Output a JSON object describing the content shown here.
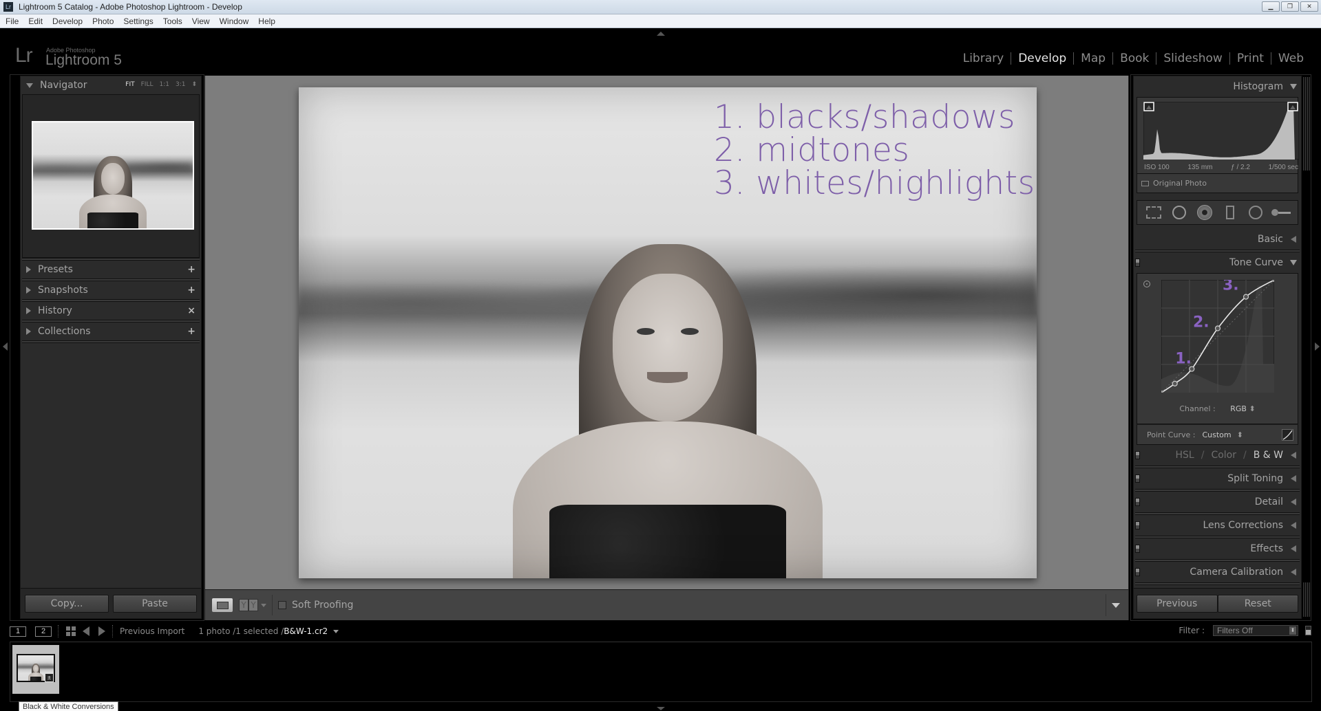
{
  "window": {
    "title": "Lightroom 5 Catalog - Adobe Photoshop Lightroom - Develop",
    "app_icon": "Lr",
    "controls": [
      "minimize",
      "restore",
      "close"
    ]
  },
  "menu": [
    "File",
    "Edit",
    "Develop",
    "Photo",
    "Settings",
    "Tools",
    "View",
    "Window",
    "Help"
  ],
  "brand": {
    "logo": "Lr",
    "small": "Adobe Photoshop",
    "big": "Lightroom 5"
  },
  "modules": [
    {
      "label": "Library",
      "active": false
    },
    {
      "label": "Develop",
      "active": true
    },
    {
      "label": "Map",
      "active": false
    },
    {
      "label": "Book",
      "active": false
    },
    {
      "label": "Slideshow",
      "active": false
    },
    {
      "label": "Print",
      "active": false
    },
    {
      "label": "Web",
      "active": false
    }
  ],
  "left_panel": {
    "navigator": {
      "title": "Navigator",
      "zoom_options": [
        "FIT",
        "FILL",
        "1:1",
        "3:1"
      ],
      "active_zoom": "FIT"
    },
    "sections": [
      {
        "label": "Presets",
        "action": "+"
      },
      {
        "label": "Snapshots",
        "action": "+"
      },
      {
        "label": "History",
        "action": "×"
      },
      {
        "label": "Collections",
        "action": "+"
      }
    ],
    "buttons": {
      "copy": "Copy...",
      "paste": "Paste"
    }
  },
  "main": {
    "annotation": [
      "1. blacks/shadows",
      "2. midtones",
      "3. whites/highlights"
    ],
    "annotation_color": "#7e5fa9"
  },
  "toolbar": {
    "yy_label": "Y",
    "soft_proofing": "Soft Proofing",
    "soft_proofing_checked": false
  },
  "right_panel": {
    "histogram": {
      "title": "Histogram",
      "iso": "ISO 100",
      "focal": "135 mm",
      "aperture": "ƒ / 2.2",
      "shutter": "1/500 sec",
      "original_photo": "Original Photo"
    },
    "tools": [
      "crop-overlay",
      "spot-removal",
      "red-eye-correction",
      "graduated-filter",
      "radial-filter",
      "adjustment-brush"
    ],
    "basic": "Basic",
    "tone_curve": {
      "title": "Tone Curve",
      "channel_label": "Channel :",
      "channel_value": "RGB",
      "point_curve_label": "Point Curve :",
      "point_curve_value": "Custom",
      "markers": [
        "1.",
        "2.",
        "3."
      ],
      "curve_points": [
        [
          0,
          0
        ],
        [
          0.12,
          0.08
        ],
        [
          0.27,
          0.21
        ],
        [
          0.5,
          0.57
        ],
        [
          0.75,
          0.85
        ],
        [
          1,
          1
        ]
      ]
    },
    "hsl": {
      "hsl": "HSL",
      "color": "Color",
      "bw": "B & W"
    },
    "sections": [
      "Split Toning",
      "Detail",
      "Lens Corrections",
      "Effects",
      "Camera Calibration"
    ],
    "buttons": {
      "previous": "Previous",
      "reset": "Reset"
    }
  },
  "filmbar": {
    "screen1": "1",
    "screen2": "2",
    "source": "Previous Import",
    "count": "1 photo /1 selected /",
    "filename": "B&W-1.cr2",
    "filter_label": "Filter :",
    "filter_value": "Filters Off"
  },
  "filmstrip": {
    "tooltip": "Black & White Conversions"
  }
}
